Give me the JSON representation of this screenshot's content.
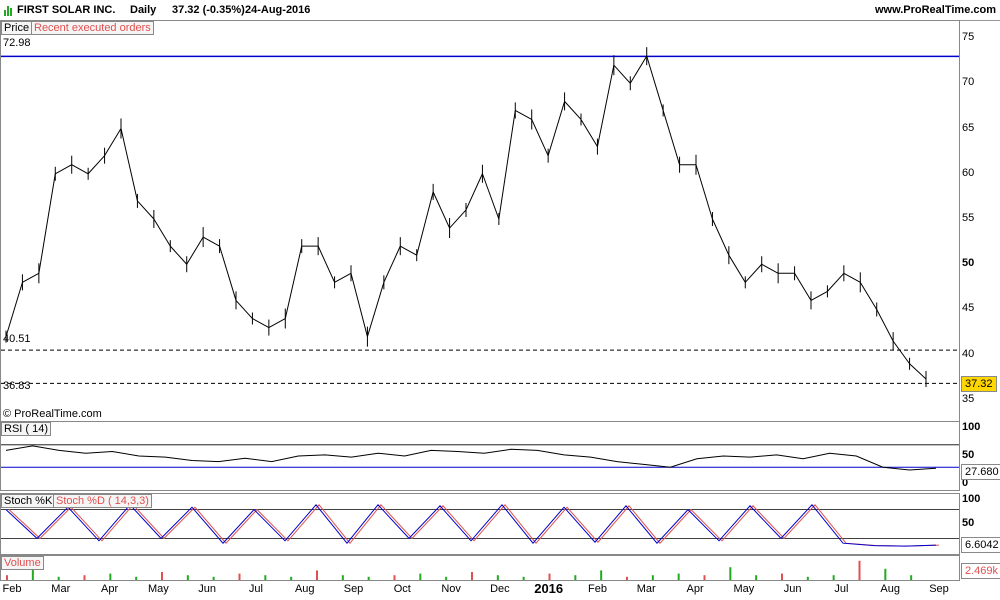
{
  "header": {
    "symbol": "FIRST SOLAR INC.",
    "period": "Daily",
    "quote": "37.32 (-0.35%)",
    "date": "24-Aug-2016",
    "site": "www.ProRealTime.com"
  },
  "price_panel": {
    "label": "Price",
    "orders_label": "Recent executed orders",
    "level_high": "72.98",
    "level_mid": "40.51",
    "level_low": "36.83",
    "last_value": "37.32",
    "copyright": "© ProRealTime.com",
    "y_ticks": [
      {
        "label": "75",
        "v": 75,
        "bold": false
      },
      {
        "label": "70",
        "v": 70,
        "bold": false
      },
      {
        "label": "65",
        "v": 65,
        "bold": false
      },
      {
        "label": "60",
        "v": 60,
        "bold": false
      },
      {
        "label": "55",
        "v": 55,
        "bold": false
      },
      {
        "label": "50",
        "v": 50,
        "bold": true
      },
      {
        "label": "45",
        "v": 45,
        "bold": false
      },
      {
        "label": "40",
        "v": 40,
        "bold": false
      },
      {
        "label": "35",
        "v": 35,
        "bold": false
      }
    ],
    "colors": {
      "resistance": "#0000cc",
      "box": "#ffd700"
    }
  },
  "rsi_panel": {
    "label": "RSI ( 14)",
    "last_value": "27.680",
    "y_ticks": [
      {
        "label": "100",
        "v": 100
      },
      {
        "label": "50",
        "v": 50
      },
      {
        "label": "0",
        "v": 0
      }
    ]
  },
  "stoch_panel": {
    "label_k": "Stoch %K",
    "label_d": "Stoch %D ( 14,3,3)",
    "last_value": "6.6042",
    "y_ticks": [
      {
        "label": "100",
        "v": 100
      },
      {
        "label": "50",
        "v": 50
      }
    ]
  },
  "volume_panel": {
    "label": "Volume",
    "last_value": "2.469k"
  },
  "x_axis": [
    {
      "label": "Feb",
      "bold": false
    },
    {
      "label": "Mar",
      "bold": false
    },
    {
      "label": "Apr",
      "bold": false
    },
    {
      "label": "May",
      "bold": false
    },
    {
      "label": "Jun",
      "bold": false
    },
    {
      "label": "Jul",
      "bold": false
    },
    {
      "label": "Aug",
      "bold": false
    },
    {
      "label": "Sep",
      "bold": false
    },
    {
      "label": "Oct",
      "bold": false
    },
    {
      "label": "Nov",
      "bold": false
    },
    {
      "label": "Dec",
      "bold": false
    },
    {
      "label": "2016",
      "bold": true
    },
    {
      "label": "Feb",
      "bold": false
    },
    {
      "label": "Mar",
      "bold": false
    },
    {
      "label": "Apr",
      "bold": false
    },
    {
      "label": "May",
      "bold": false
    },
    {
      "label": "Jun",
      "bold": false
    },
    {
      "label": "Jul",
      "bold": false
    },
    {
      "label": "Aug",
      "bold": false
    },
    {
      "label": "Sep",
      "bold": false
    }
  ],
  "chart_data": {
    "type": "line",
    "title": "FIRST SOLAR INC. Daily",
    "price_series": [
      {
        "x": "Feb 2015",
        "close": 42
      },
      {
        "x": "Feb 2015",
        "close": 48
      },
      {
        "x": "Feb 2015",
        "close": 49
      },
      {
        "x": "Mar 2015",
        "close": 60
      },
      {
        "x": "Mar 2015",
        "close": 61
      },
      {
        "x": "Apr 2015",
        "close": 60
      },
      {
        "x": "Apr 2015",
        "close": 62
      },
      {
        "x": "Apr 2015",
        "close": 65
      },
      {
        "x": "May 2015",
        "close": 57
      },
      {
        "x": "May 2015",
        "close": 55
      },
      {
        "x": "Jun 2015",
        "close": 52
      },
      {
        "x": "Jun 2015",
        "close": 50
      },
      {
        "x": "Jun 2015",
        "close": 53
      },
      {
        "x": "Jul 2015",
        "close": 52
      },
      {
        "x": "Jul 2015",
        "close": 46
      },
      {
        "x": "Jul 2015",
        "close": 44
      },
      {
        "x": "Aug 2015",
        "close": 43
      },
      {
        "x": "Aug 2015",
        "close": 44
      },
      {
        "x": "Aug 2015",
        "close": 52
      },
      {
        "x": "Sep 2015",
        "close": 52
      },
      {
        "x": "Sep 2015",
        "close": 48
      },
      {
        "x": "Sep 2015",
        "close": 49
      },
      {
        "x": "Oct 2015",
        "close": 42
      },
      {
        "x": "Oct 2015",
        "close": 48
      },
      {
        "x": "Oct 2015",
        "close": 52
      },
      {
        "x": "Nov 2015",
        "close": 51
      },
      {
        "x": "Nov 2015",
        "close": 58
      },
      {
        "x": "Nov 2015",
        "close": 54
      },
      {
        "x": "Dec 2015",
        "close": 56
      },
      {
        "x": "Dec 2015",
        "close": 60
      },
      {
        "x": "Dec 2015",
        "close": 55
      },
      {
        "x": "Jan 2016",
        "close": 67
      },
      {
        "x": "Jan 2016",
        "close": 66
      },
      {
        "x": "Jan 2016",
        "close": 62
      },
      {
        "x": "Feb 2016",
        "close": 68
      },
      {
        "x": "Feb 2016",
        "close": 66
      },
      {
        "x": "Feb 2016",
        "close": 63
      },
      {
        "x": "Mar 2016",
        "close": 72
      },
      {
        "x": "Mar 2016",
        "close": 70
      },
      {
        "x": "Mar 2016",
        "close": 73
      },
      {
        "x": "Apr 2016",
        "close": 67
      },
      {
        "x": "Apr 2016",
        "close": 61
      },
      {
        "x": "Apr 2016",
        "close": 61
      },
      {
        "x": "May 2016",
        "close": 55
      },
      {
        "x": "May 2016",
        "close": 51
      },
      {
        "x": "May 2016",
        "close": 48
      },
      {
        "x": "Jun 2016",
        "close": 50
      },
      {
        "x": "Jun 2016",
        "close": 49
      },
      {
        "x": "Jun 2016",
        "close": 49
      },
      {
        "x": "Jul 2016",
        "close": 46
      },
      {
        "x": "Jul 2016",
        "close": 47
      },
      {
        "x": "Jul 2016",
        "close": 49
      },
      {
        "x": "Aug 2016",
        "close": 48
      },
      {
        "x": "Aug 2016",
        "close": 45
      },
      {
        "x": "Aug 2016",
        "close": 41.5
      },
      {
        "x": "Aug 2016",
        "close": 39
      },
      {
        "x": "Aug 2016",
        "close": 37.32
      }
    ],
    "rsi_series": [
      60,
      68,
      60,
      55,
      58,
      50,
      48,
      42,
      40,
      46,
      40,
      50,
      52,
      48,
      55,
      50,
      60,
      58,
      55,
      62,
      60,
      52,
      48,
      40,
      35,
      30,
      45,
      50,
      48,
      52,
      45,
      55,
      50,
      30,
      25,
      28
    ],
    "stoch_series": [
      80,
      20,
      85,
      15,
      90,
      20,
      85,
      10,
      80,
      15,
      90,
      10,
      90,
      20,
      88,
      15,
      90,
      10,
      85,
      12,
      88,
      10,
      80,
      15,
      88,
      20,
      90,
      10,
      5,
      4,
      6
    ],
    "volume_series": [
      3,
      9,
      2,
      3,
      4,
      2,
      5,
      3,
      2,
      4,
      3,
      2,
      6,
      3,
      2,
      3,
      4,
      2,
      5,
      3,
      2,
      4,
      3,
      6,
      2,
      3,
      4,
      3,
      8,
      3,
      4,
      2,
      3,
      12,
      7,
      3
    ],
    "resistance": 72.98,
    "support_lines": [
      40.51,
      36.83
    ],
    "ylim": [
      34,
      76
    ]
  }
}
